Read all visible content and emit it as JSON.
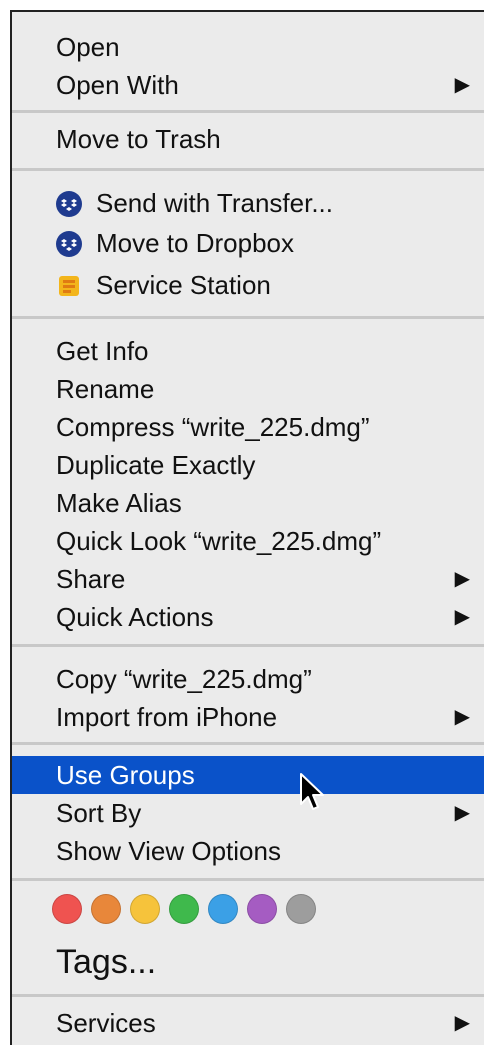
{
  "menu": {
    "items": [
      {
        "label": "Open",
        "has_submenu": false
      },
      {
        "label": "Open With",
        "has_submenu": true,
        "arrow": "▶"
      },
      {
        "label": "Move to Trash",
        "has_submenu": false
      },
      {
        "label": "Send with Transfer...",
        "icon": "dropbox-icon"
      },
      {
        "label": "Move to Dropbox",
        "icon": "dropbox-icon"
      },
      {
        "label": "Service Station",
        "icon": "service-station-icon"
      },
      {
        "label": "Get Info"
      },
      {
        "label": "Rename"
      },
      {
        "label": "Compress “write_225.dmg”"
      },
      {
        "label": "Duplicate Exactly"
      },
      {
        "label": "Make Alias"
      },
      {
        "label": "Quick Look “write_225.dmg”"
      },
      {
        "label": "Share",
        "has_submenu": true,
        "arrow": "▶"
      },
      {
        "label": "Quick Actions",
        "has_submenu": true,
        "arrow": "▶"
      },
      {
        "label": "Copy “write_225.dmg”"
      },
      {
        "label": "Import from iPhone",
        "has_submenu": true,
        "arrow": "▶"
      },
      {
        "label": "Use Groups",
        "highlighted": true
      },
      {
        "label": "Sort By",
        "has_submenu": true,
        "arrow": "▶"
      },
      {
        "label": "Show View Options"
      },
      {
        "label": "Services",
        "has_submenu": true,
        "arrow": "▶"
      }
    ],
    "tags_label": "Tags...",
    "tag_colors": [
      "#ef5350",
      "#e8873a",
      "#f6c33b",
      "#3fb94c",
      "#3ba0e6",
      "#a55cc2",
      "#9d9d9d"
    ],
    "highlight_color": "#0a52c9"
  }
}
